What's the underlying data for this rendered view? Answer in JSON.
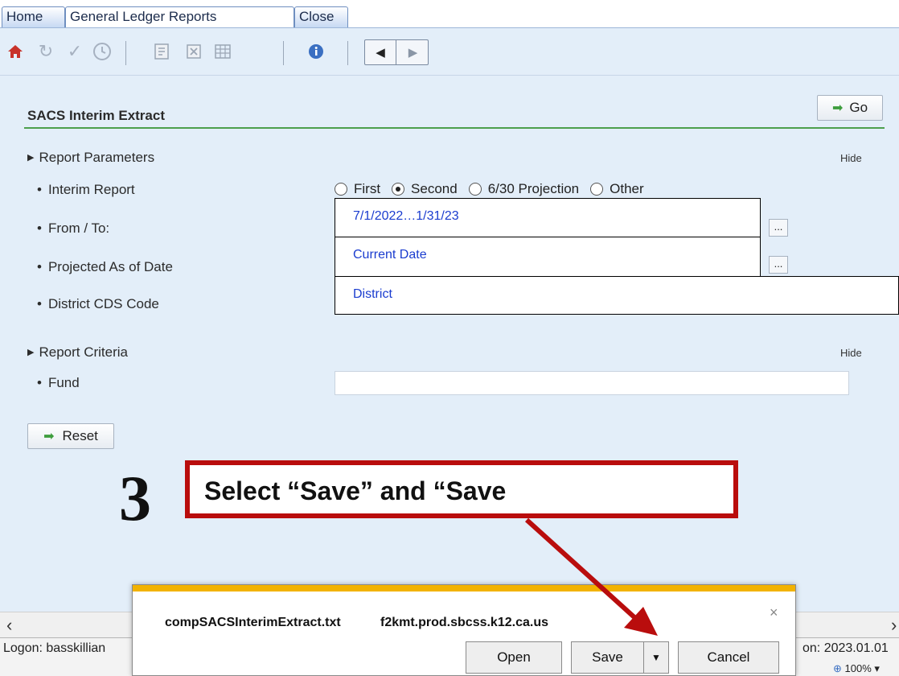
{
  "tabs": [
    {
      "label": "Home"
    },
    {
      "label": "General Ledger Reports"
    },
    {
      "label": "Close"
    }
  ],
  "toolbar": {
    "icons": [
      "home-icon",
      "refresh-icon",
      "check-icon",
      "clock-icon",
      "pdf-icon",
      "excel-icon",
      "grid-icon",
      "info-icon",
      "arrow-left-icon",
      "arrow-right-icon"
    ]
  },
  "page": {
    "title": "SACS Interim Extract",
    "go_label": "Go"
  },
  "parameters": {
    "section_label": "Report Parameters",
    "hide_label": "Hide",
    "interim_report_label": "Interim Report",
    "radio_options": [
      {
        "label": "First",
        "selected": false
      },
      {
        "label": "Second",
        "selected": true
      },
      {
        "label": "6/30 Projection",
        "selected": false
      },
      {
        "label": "Other",
        "selected": false
      }
    ],
    "from_to_label": "From / To:",
    "from_to_value": "7/1/2022…1/31/23",
    "projected_label": "Projected As of Date",
    "projected_value": "Current Date",
    "cds_label": "District CDS Code",
    "cds_value": "District",
    "dots_label": "..."
  },
  "criteria": {
    "section_label": "Report Criteria",
    "hide_label": "Hide",
    "fund_label": "Fund",
    "fund_value": ""
  },
  "reset_label": "Reset",
  "annotation": {
    "step": "3",
    "text": "Select “Save” and “Save"
  },
  "status": {
    "logon": "Logon: basskillian",
    "version": "on: 2023.01.01",
    "zoom": "100%"
  },
  "download": {
    "filename": "compSACSInterimExtract.txt",
    "host": "f2kmt.prod.sbcss.k12.ca.us",
    "close": "×",
    "open_label": "Open",
    "save_label": "Save",
    "save_menu": "▼",
    "cancel_label": "Cancel"
  },
  "colors": {
    "accent_green": "#3d9d3d",
    "link_blue": "#1a3ccf",
    "callout_red": "#b90d0d",
    "notification_yellow": "#f2b200"
  }
}
